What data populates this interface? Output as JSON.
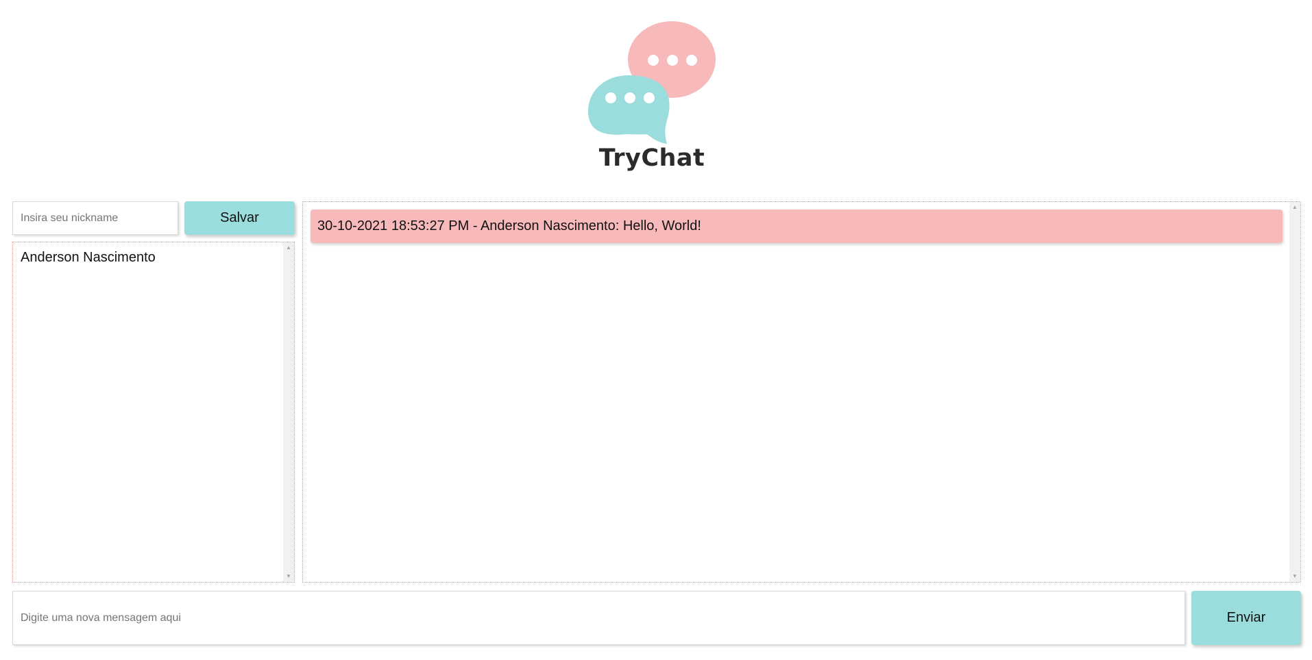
{
  "app": {
    "title": "TryChat"
  },
  "colors": {
    "accent_teal": "#9bdcdc",
    "accent_pink": "#f8b9bb",
    "panel_border": "#f08a8a",
    "logo_text": "#2b2b2b"
  },
  "nickname": {
    "placeholder": "Insira seu nickname",
    "value": "",
    "save_label": "Salvar"
  },
  "users": [
    {
      "name": "Anderson Nascimento"
    }
  ],
  "messages": [
    {
      "text": "30-10-2021 18:53:27 PM - Anderson Nascimento: Hello, World!"
    }
  ],
  "composer": {
    "placeholder": "Digite uma nova mensagem aqui",
    "value": "",
    "send_label": "Enviar"
  },
  "icons": {
    "logo": "chat-bubbles-icon",
    "scroll_up": "scroll-up-arrow-icon",
    "scroll_down": "scroll-down-arrow-icon"
  }
}
